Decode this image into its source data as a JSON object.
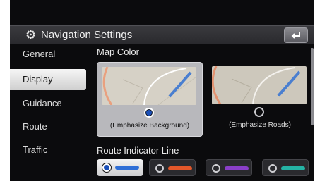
{
  "header": {
    "title": "Navigation Settings",
    "settings_icon": "gear-icon",
    "back_icon": "back-arrow-icon"
  },
  "sidebar": {
    "items": [
      {
        "label": "General"
      },
      {
        "label": "Display",
        "active": true
      },
      {
        "label": "Guidance"
      },
      {
        "label": "Route"
      },
      {
        "label": "Traffic"
      }
    ]
  },
  "map_color": {
    "label": "Map Color",
    "options": [
      {
        "label": "(Emphasize Background)",
        "selected": true
      },
      {
        "label": "(Emphasize Roads)",
        "selected": false
      }
    ]
  },
  "route_line": {
    "label": "Route Indicator Line",
    "options": [
      {
        "color": "#2f6fd6",
        "selected": true
      },
      {
        "color": "#e2572a",
        "selected": false
      },
      {
        "color": "#8a3fc8",
        "selected": false
      },
      {
        "color": "#25b3a5",
        "selected": false
      }
    ]
  },
  "colors": {
    "accent": "#1a4fb8",
    "background": "#0b0b0d"
  }
}
